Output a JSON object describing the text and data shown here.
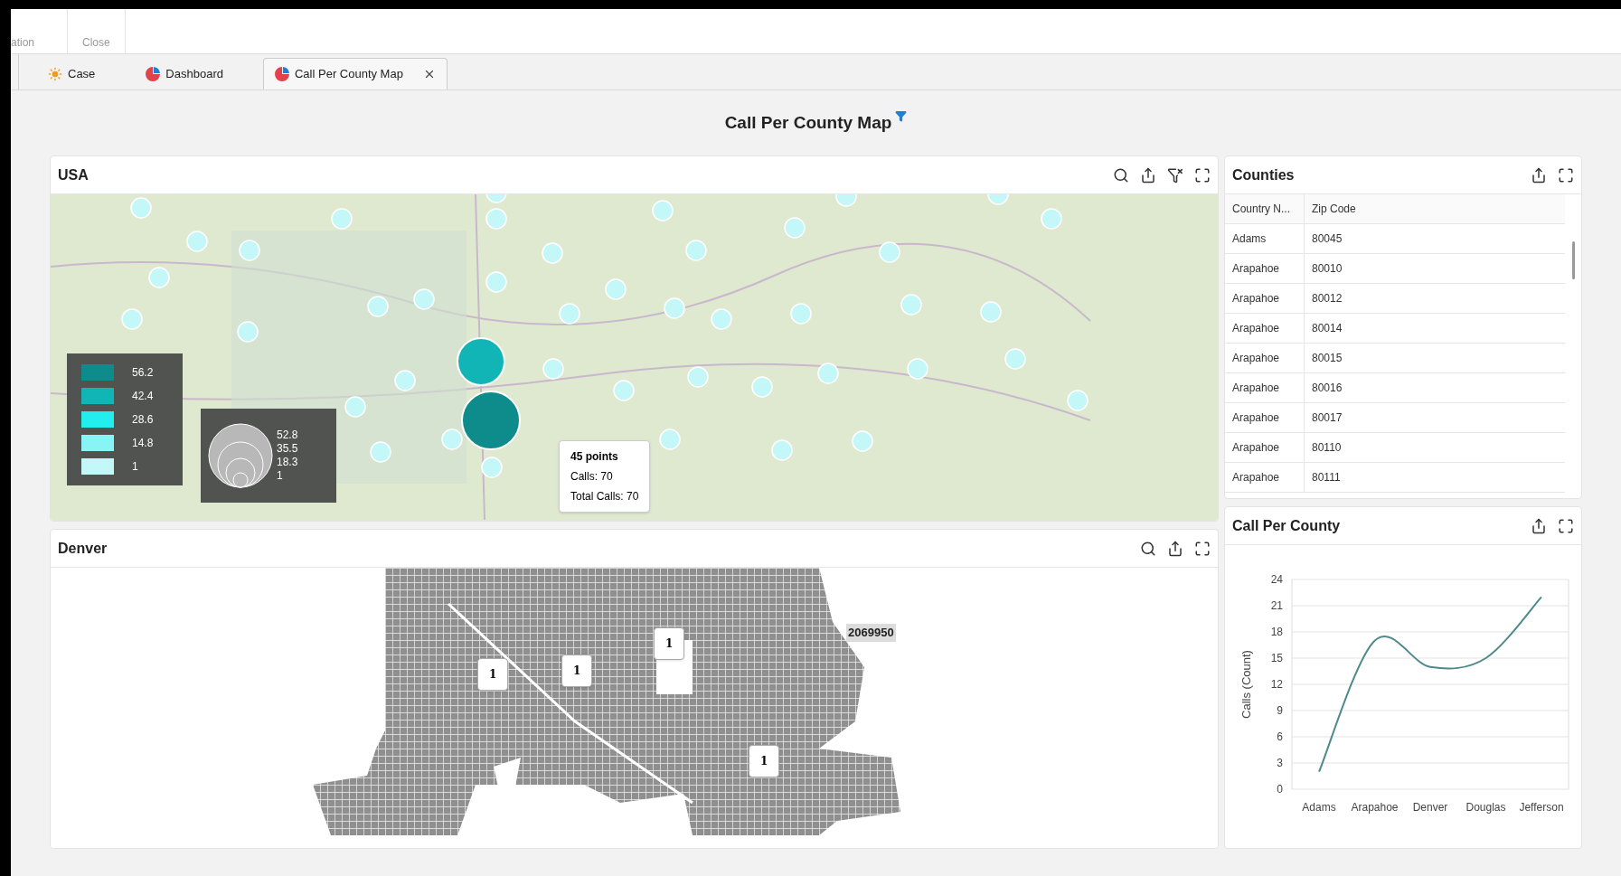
{
  "ribbon": {
    "items": [
      {
        "label": "ation"
      },
      {
        "label": "Close"
      }
    ]
  },
  "tabs": [
    {
      "label": "Case",
      "kind": "case",
      "selected": false,
      "closable": false
    },
    {
      "label": "Dashboard",
      "kind": "dashboard",
      "selected": false,
      "closable": false
    },
    {
      "label": "Call Per County Map",
      "kind": "dashboard",
      "selected": true,
      "closable": true
    }
  ],
  "page_title": "Call Per County Map",
  "usa_panel": {
    "title": "USA",
    "legend": [
      {
        "value": "56.2",
        "color": "#0e8b8b"
      },
      {
        "value": "42.4",
        "color": "#11b5b5"
      },
      {
        "value": "28.6",
        "color": "#22eeee"
      },
      {
        "value": "14.8",
        "color": "#88f4f4"
      },
      {
        "value": "1",
        "color": "#c4f8f8"
      }
    ],
    "bubble_legend": [
      "52.8",
      "35.5",
      "18.3",
      "1"
    ],
    "tooltip": {
      "title": "45 points",
      "lines": [
        "Calls: 70",
        "Total Calls: 70"
      ]
    }
  },
  "denver_panel": {
    "title": "Denver",
    "markers": [
      {
        "label": "1",
        "kind": "callout"
      },
      {
        "label": "1",
        "kind": "callout"
      },
      {
        "label": "1",
        "kind": "callout"
      },
      {
        "label": "1",
        "kind": "callout"
      },
      {
        "label": "2069950",
        "kind": "plain"
      }
    ]
  },
  "counties_panel": {
    "title": "Counties",
    "columns": [
      "Country N...",
      "Zip Code"
    ],
    "rows": [
      [
        "Adams",
        "80045"
      ],
      [
        "Arapahoe",
        "80010"
      ],
      [
        "Arapahoe",
        "80012"
      ],
      [
        "Arapahoe",
        "80014"
      ],
      [
        "Arapahoe",
        "80015"
      ],
      [
        "Arapahoe",
        "80016"
      ],
      [
        "Arapahoe",
        "80017"
      ],
      [
        "Arapahoe",
        "80110"
      ],
      [
        "Arapahoe",
        "80111"
      ]
    ]
  },
  "chart_panel": {
    "title": "Call Per County",
    "chart_data": {
      "type": "line",
      "ylabel": "Calls (Count)",
      "categories": [
        "Adams",
        "Arapahoe",
        "Denver",
        "Douglas",
        "Jefferson"
      ],
      "grid": true,
      "series": [
        {
          "color": "#4f8a8b",
          "values": [
            2,
            17,
            14,
            15,
            22
          ]
        }
      ],
      "ylim": [
        0,
        24
      ],
      "yticks": [
        0,
        3,
        6,
        9,
        12,
        15,
        18,
        21,
        24
      ]
    }
  }
}
